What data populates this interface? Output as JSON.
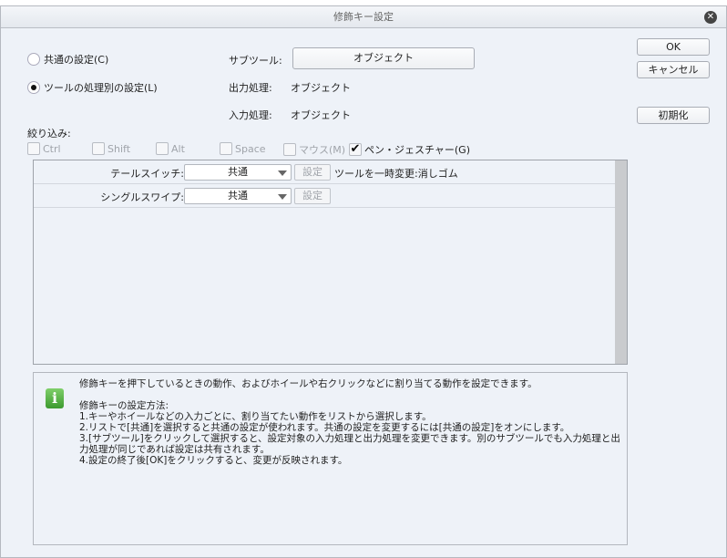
{
  "title": "修飾キー設定",
  "radios": [
    {
      "label": "共通の設定(C)",
      "checked": false
    },
    {
      "label": "ツールの処理別の設定(L)",
      "checked": true
    }
  ],
  "subtool_label": "サブツール:",
  "subtool_value": "オブジェクト",
  "output_label": "出力処理:",
  "output_value": "オブジェクト",
  "input_label": "入力処理:",
  "input_value": "オブジェクト",
  "buttons": {
    "ok": "OK",
    "cancel": "キャンセル",
    "reset": "初期化"
  },
  "filter_label": "絞り込み:",
  "filters": [
    {
      "label": "Ctrl",
      "checked": false
    },
    {
      "label": "Shift",
      "checked": false
    },
    {
      "label": "Alt",
      "checked": false
    },
    {
      "label": "Space",
      "checked": false
    },
    {
      "label": "マウス(M)",
      "checked": false
    },
    {
      "label": "ペン・ジェスチャー(G)",
      "checked": true
    }
  ],
  "rows": [
    {
      "label": "テールスイッチ:",
      "value": "共通",
      "button": "設定",
      "note": "ツールを一時変更:消しゴム"
    },
    {
      "label": "シングルスワイプ:",
      "value": "共通",
      "button": "設定",
      "note": ""
    }
  ],
  "info": {
    "icon": "info-icon",
    "lines": [
      "修飾キーを押下しているときの動作、およびホイールや右クリックなどに割り当てる動作を設定できます。",
      "",
      "修飾キーの設定方法:",
      "1.キーやホイールなどの入力ごとに、割り当てたい動作をリストから選択します。",
      "2.リストで[共通]を選択すると共通の設定が使われます。共通の設定を変更するには[共通の設定]をオンにします。",
      "3.[サブツール]をクリックして選択すると、設定対象の入力処理と出力処理を変更できます。別のサブツールでも入力処理と出力処理が同じであれば設定は共有されます。",
      "4.設定の終了後[OK]をクリックすると、変更が反映されます。"
    ]
  }
}
